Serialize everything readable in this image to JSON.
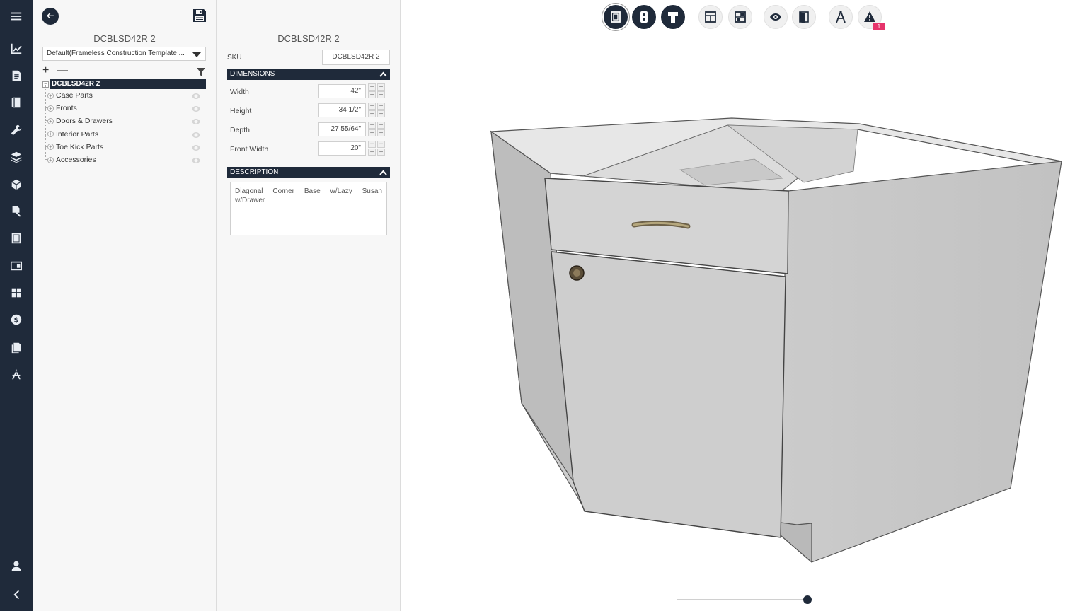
{
  "rail": {
    "items": [
      "menu-icon",
      "chart-icon",
      "document-icon",
      "book-icon",
      "tools-icon",
      "layers-icon",
      "cube-icon",
      "parts-icon",
      "cabinet-icon",
      "panel-icon",
      "grid-icon",
      "price-icon",
      "reports-icon",
      "drafting-icon",
      "user-icon",
      "collapse-icon"
    ]
  },
  "tree_panel": {
    "title": "DCBLSD42R 2",
    "template": "Default(Frameless Construction Template ...",
    "plus": "+",
    "minus": "—",
    "root": "DCBLSD42R 2",
    "items": [
      "Case Parts",
      "Fronts",
      "Doors & Drawers",
      "Interior Parts",
      "Toe Kick Parts",
      "Accessories"
    ]
  },
  "props": {
    "title": "DCBLSD42R 2",
    "sku_label": "SKU",
    "sku_value": "DCBLSD42R 2",
    "dimensions_header": "DIMENSIONS",
    "dimensions": [
      {
        "label": "Width",
        "value": "42\""
      },
      {
        "label": "Height",
        "value": "34 1/2\""
      },
      {
        "label": "Depth",
        "value": "27 55/64\""
      },
      {
        "label": "Front Width",
        "value": "20\""
      }
    ],
    "description_header": "DESCRIPTION",
    "description": "Diagonal Corner Base w/Lazy Susan w/Drawer"
  },
  "viewport": {
    "warning_count": "1",
    "accent": "#1f2a3a",
    "badge_color": "#e6336b"
  }
}
